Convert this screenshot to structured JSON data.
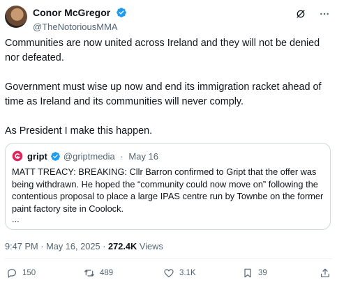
{
  "author": {
    "display_name": "Conor McGregor",
    "handle": "@TheNotoriousMMA",
    "avatar_icon": "profile-photo",
    "verified_icon": "verified-badge-icon"
  },
  "header_actions": [
    "grok-icon",
    "more-icon"
  ],
  "tweet": {
    "paragraphs": [
      "Communities are now united across Ireland and they will not be denied nor defeated.",
      "Government must wise up now and end its immigration racket ahead of time as Ireland and its communities will never comply.",
      "As President I make this happen."
    ]
  },
  "quote": {
    "display_name": "gript",
    "handle": "@griptmedia",
    "separator": "·",
    "date": "May 16",
    "text": "MATT TREACY: BREAKING: Cllr Barron confirmed to Gript that the offer was being withdrawn. He hoped the “community could now move on” following the contentious proposal to place a large IPAS centre run by Townbe on the former paint factory site in Coolock.",
    "ellipsis": "..."
  },
  "meta": {
    "time": "9:47 PM",
    "separator": "·",
    "date": "May 16, 2025",
    "separator2": "·",
    "views_count": "272.4K",
    "views_label": "Views"
  },
  "actions": {
    "replies": "150",
    "reposts": "489",
    "likes": "3.1K",
    "bookmarks": "39"
  },
  "colors": {
    "accent": "#1d9bf0",
    "text": "#0f1419",
    "secondary": "#536471",
    "border": "#cfd9de",
    "gript_red": "#e0245e"
  }
}
